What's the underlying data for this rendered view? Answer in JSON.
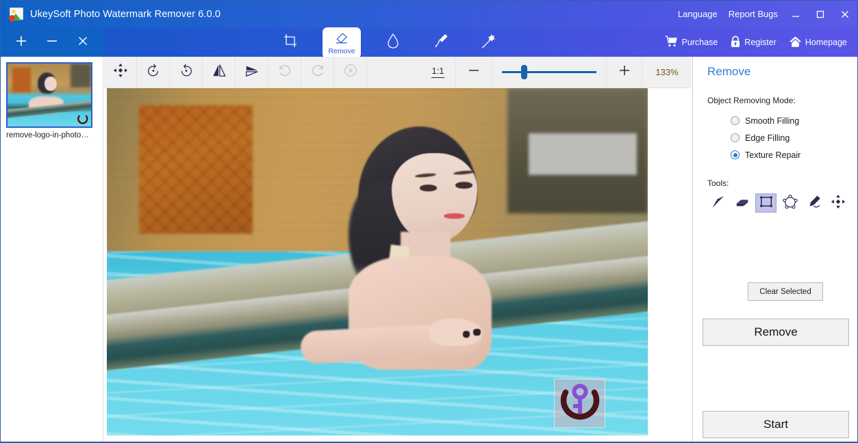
{
  "window": {
    "title": "UkeySoft Photo Watermark Remover 6.0.0",
    "logo_icon": "app-photo-icon",
    "titlebar_gradient_from": "#0f62c4",
    "titlebar_gradient_to": "#5b5be6",
    "links": [
      {
        "label": "Language",
        "name": "language-menu"
      },
      {
        "label": "Report Bugs",
        "name": "report-bugs-link"
      }
    ],
    "controls": [
      {
        "name": "minimize-button",
        "icon": "minimize-icon"
      },
      {
        "name": "maximize-button",
        "icon": "maximize-icon"
      },
      {
        "name": "close-button",
        "icon": "close-icon"
      }
    ]
  },
  "thumb_tools": [
    {
      "name": "add-photo-button",
      "icon": "plus-icon",
      "glyph": "+"
    },
    {
      "name": "remove-photo-button",
      "icon": "minus-icon",
      "glyph": "−"
    },
    {
      "name": "clear-all-button",
      "icon": "close-icon",
      "glyph": "✕"
    }
  ],
  "main_toolbar": {
    "items": [
      {
        "label": "",
        "icon": "crop-icon",
        "name": "tool-crop",
        "active": false
      },
      {
        "label": "Remove",
        "icon": "eraser-icon",
        "name": "tool-remove",
        "active": true
      },
      {
        "label": "",
        "icon": "water-drop-icon",
        "name": "tool-retouch",
        "active": false
      },
      {
        "label": "",
        "icon": "paintbrush-icon",
        "name": "tool-brush",
        "active": false
      },
      {
        "label": "",
        "icon": "magic-wand-icon",
        "name": "tool-magic-wand",
        "active": false
      }
    ],
    "right_links": [
      {
        "label": "Purchase",
        "icon": "shopping-cart-icon",
        "name": "purchase-link"
      },
      {
        "label": "Register",
        "icon": "lock-icon",
        "name": "register-link"
      },
      {
        "label": "Homepage",
        "icon": "home-icon",
        "name": "homepage-link"
      }
    ]
  },
  "file_list": {
    "items": [
      {
        "label": "remove-logo-in-photo…",
        "selected": true
      }
    ]
  },
  "canvas_toolbar": {
    "buttons": [
      {
        "name": "pan-move-button",
        "icon": "move-icon",
        "disabled": false
      },
      {
        "name": "rotate-left-button",
        "icon": "rotate-left-icon",
        "disabled": false
      },
      {
        "name": "rotate-right-button",
        "icon": "rotate-right-icon",
        "disabled": false
      },
      {
        "name": "flip-horizontal-button",
        "icon": "flip-horizontal-icon",
        "disabled": false
      },
      {
        "name": "flip-vertical-button",
        "icon": "flip-vertical-icon",
        "disabled": false
      },
      {
        "name": "undo-button",
        "icon": "undo-icon",
        "disabled": true
      },
      {
        "name": "redo-button",
        "icon": "redo-icon",
        "disabled": true
      },
      {
        "name": "reset-button",
        "icon": "reset-circle-x-icon",
        "disabled": true
      }
    ],
    "fit_label": "1:1",
    "zoom_out_label": "−",
    "zoom_in_label": "+",
    "zoom_percent": "133%",
    "zoom_percent_color": "#6b5a1a",
    "slider_position_pct": 20
  },
  "photo": {
    "watermark": {
      "name": "watermark-logo",
      "selection_color": "#eca4b0",
      "ring_color": "#4a1419",
      "key_color": "#8a4fd0"
    }
  },
  "right_panel": {
    "title": "Remove",
    "title_color": "#2b7cd3",
    "mode_label": "Object Removing Mode:",
    "modes": [
      {
        "label": "Smooth Filling",
        "selected": false
      },
      {
        "label": "Edge Filling",
        "selected": false
      },
      {
        "label": "Texture Repair",
        "selected": true
      }
    ],
    "tools_label": "Tools:",
    "tools": [
      {
        "name": "tool-brush",
        "icon": "paintbrush-icon",
        "selected": false
      },
      {
        "name": "tool-eraser",
        "icon": "eraser-icon",
        "selected": false
      },
      {
        "name": "tool-rectangle-select",
        "icon": "rectangle-select-icon",
        "selected": true
      },
      {
        "name": "tool-polygon-select",
        "icon": "polygon-select-icon",
        "selected": false
      },
      {
        "name": "tool-lasso-pen",
        "icon": "pen-lasso-icon",
        "selected": false
      },
      {
        "name": "tool-move",
        "icon": "move-icon",
        "selected": false
      }
    ],
    "clear_selected_label": "Clear Selected",
    "remove_label": "Remove",
    "start_label": "Start"
  }
}
